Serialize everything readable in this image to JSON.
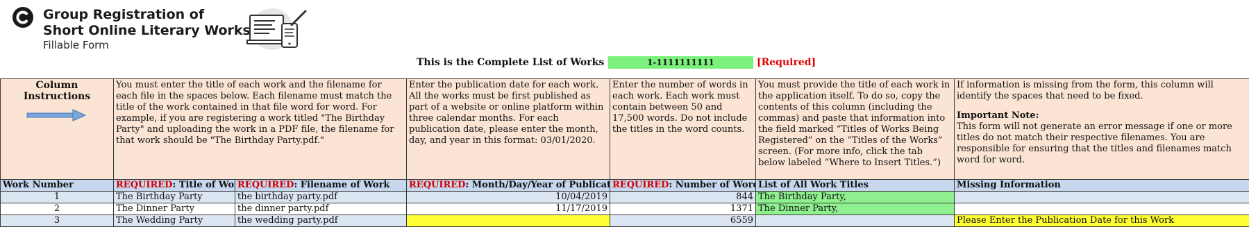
{
  "header": {
    "title_line1": "Group Registration of",
    "title_line2": "Short Online Literary Works",
    "subtitle": "Fillable Form"
  },
  "complete_list": {
    "label": "This is the Complete List of Works for:",
    "value": "1-1111111111",
    "required": "[Required]"
  },
  "instructions": {
    "col_label": "Column Instructions",
    "title_file": "You must enter the title of each work and the filename for each file in the spaces below. Each filename must match the title of the work contained in that file word for word. For example, if you are registering a work titled \"The Birthday Party\" and uploading the work in a PDF file, the filename for that work should be \"The Birthday Party.pdf.\"",
    "date": "Enter the publication date for each work. All the works must be first published as part of a website or online platform within three calendar months. For each publication date, please enter the month, day, and year in this format: 03/01/2020.",
    "words": "Enter the number of words in each work. Each work must contain between 50 and 17,500 words. Do not include the titles in the word counts.",
    "list": "You must provide the title of each work in the application itself. To do so, copy the contents of this column (including the commas) and paste that information into the field marked “Titles of Works Being Registered” on the “Titles of the Works” screen. (For more info, click the tab below labeled “Where to Insert Titles.”)",
    "missing_intro": "If information is missing from the form, this column will identify the spaces that need to be fixed.",
    "important_head": "Important Note:",
    "important_body": "This form will not generate an error message if one or more titles do not match their respective filenames. You are responsible for ensuring that the titles and filenames match word for word."
  },
  "columns": {
    "work_number": "Work Number",
    "required_prefix": "REQUIRED",
    "title": ": Title of Work",
    "filename": ": Filename of Work",
    "date": ": Month/Day/Year of Publication",
    "words": ": Number of Words",
    "list": "List of All Work Titles",
    "missing": "Missing Information"
  },
  "rows": [
    {
      "num": "1",
      "title": "The Birthday Party",
      "filename": "the birthday party.pdf",
      "date": "10/04/2019",
      "words": "844",
      "list": "The Birthday Party,",
      "missing": ""
    },
    {
      "num": "2",
      "title": "The Dinner Party",
      "filename": "the dinner party.pdf",
      "date": "11/17/2019",
      "words": "1371",
      "list": "The Dinner Party,",
      "missing": ""
    },
    {
      "num": "3",
      "title": "The Wedding Party",
      "filename": "the wedding party.pdf",
      "date": "",
      "words": "6559",
      "list": "",
      "missing": "Please Enter the Publication Date for this Work"
    }
  ],
  "colors": {
    "instruction_bg": "#fbe4d3",
    "header_bg": "#c6d7ee",
    "valid_green": "#8ef08e",
    "missing_yellow": "#ffff33",
    "required_red": "#d40000"
  },
  "icons": [
    "copyright-logo-icon",
    "computer-tablet-form-icon",
    "right-arrow-icon"
  ]
}
